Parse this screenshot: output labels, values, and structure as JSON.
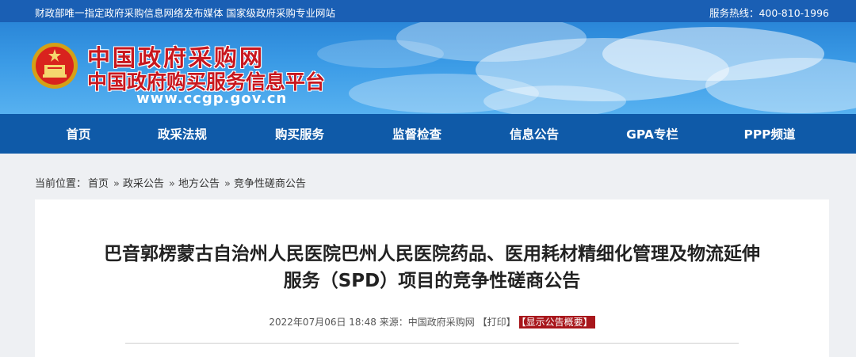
{
  "topbar": {
    "left_text": "财政部唯一指定政府采购信息网络发布媒体 国家级政府采购专业网站",
    "right_text": "服务热线：400-810-1996"
  },
  "header": {
    "site_name": "中国政府采购网",
    "site_subtitle": "中国政府购买服务信息平台",
    "site_url": "www.ccgp.gov.cn",
    "emblem_icon": "national-emblem-icon"
  },
  "nav": {
    "items": [
      {
        "label": "首页"
      },
      {
        "label": "政采法规"
      },
      {
        "label": "购买服务"
      },
      {
        "label": "监督检查"
      },
      {
        "label": "信息公告"
      },
      {
        "label": "GPA专栏"
      },
      {
        "label": "PPP频道"
      }
    ]
  },
  "breadcrumb": {
    "prefix": "当前位置：",
    "items": [
      "首页",
      "政采公告",
      "地方公告",
      "竞争性磋商公告"
    ],
    "separator": "»"
  },
  "article": {
    "title_line1": "巴音郭楞蒙古自治州人民医院巴州人民医院药品、医用耗材精细化管理及物流延伸",
    "title_line2": "服务（SPD）项目的竞争性磋商公告",
    "datetime": "2022年07月06日 18:48",
    "source_label": "来源：",
    "source": "中国政府采购网",
    "print_label": "【打印】",
    "summary_label": "【显示公告概要】"
  },
  "colors": {
    "topbar": "#1a5fb4",
    "nav": "#0f5aa8",
    "brand_red": "#c8171e",
    "tag_red": "#a8171c"
  }
}
